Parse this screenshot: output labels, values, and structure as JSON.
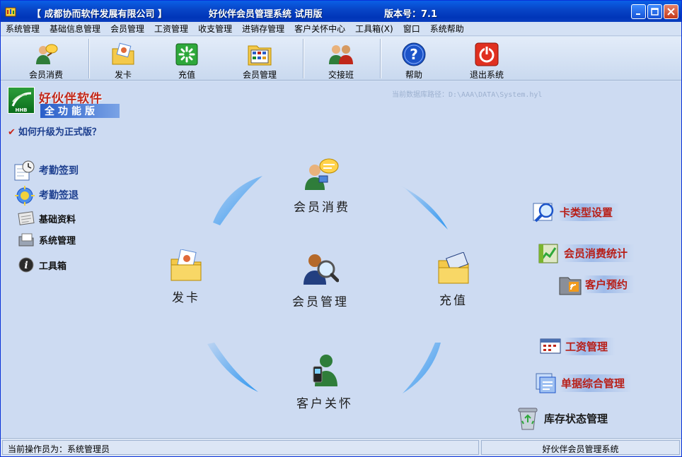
{
  "window": {
    "company": "【 成都协而软件发展有限公司 】",
    "system": "好伙伴会员管理系统 试用版",
    "version": "版本号：7.1"
  },
  "menu": [
    "系统管理",
    "基础信息管理",
    "会员管理",
    "工资管理",
    "收支管理",
    "进销存管理",
    "客户关怀中心",
    "工具箱(X)",
    "窗口",
    "系统帮助"
  ],
  "toolbar": [
    {
      "label": "会员消费",
      "icon": "member-consume-icon"
    },
    {
      "label": "发卡",
      "icon": "issue-card-icon"
    },
    {
      "label": "充值",
      "icon": "recharge-icon"
    },
    {
      "label": "会员管理",
      "icon": "member-manage-icon"
    },
    {
      "label": "交接班",
      "icon": "shift-handover-icon"
    },
    {
      "label": "帮助",
      "icon": "help-icon"
    },
    {
      "label": "退出系统",
      "icon": "exit-icon"
    }
  ],
  "logo": {
    "title": "好伙伴软件",
    "subtitle": "全功能版",
    "mark": "HHB"
  },
  "upgrade_link": "如何升级为正式版？",
  "db_path": "当前数据库路径：D:\\AAA\\DATA\\System.hyl",
  "left_links": [
    {
      "label": "考勤签到",
      "icon": "clock-in-icon"
    },
    {
      "label": "考勤签退",
      "icon": "clock-out-icon"
    },
    {
      "label": "基础资料",
      "icon": "basic-data-icon"
    },
    {
      "label": "系统管理",
      "icon": "system-manage-icon"
    },
    {
      "label": "工具箱",
      "icon": "toolbox-info-icon"
    }
  ],
  "center": {
    "consume": "会员消费",
    "issue": "发卡",
    "manage": "会员管理",
    "recharge": "充值",
    "care": "客户关怀"
  },
  "right_links": [
    {
      "label": "卡类型设置",
      "icon": "card-type-icon"
    },
    {
      "label": "会员消费统计",
      "icon": "stats-icon"
    },
    {
      "label": "客户预约",
      "icon": "appointment-icon"
    },
    {
      "label": "工资管理",
      "icon": "salary-icon"
    },
    {
      "label": "单据综合管理",
      "icon": "documents-icon"
    },
    {
      "label": "库存状态管理",
      "icon": "inventory-icon"
    }
  ],
  "status": {
    "operator": "当前操作员为：系统管理员",
    "app": "好伙伴会员管理系统"
  }
}
